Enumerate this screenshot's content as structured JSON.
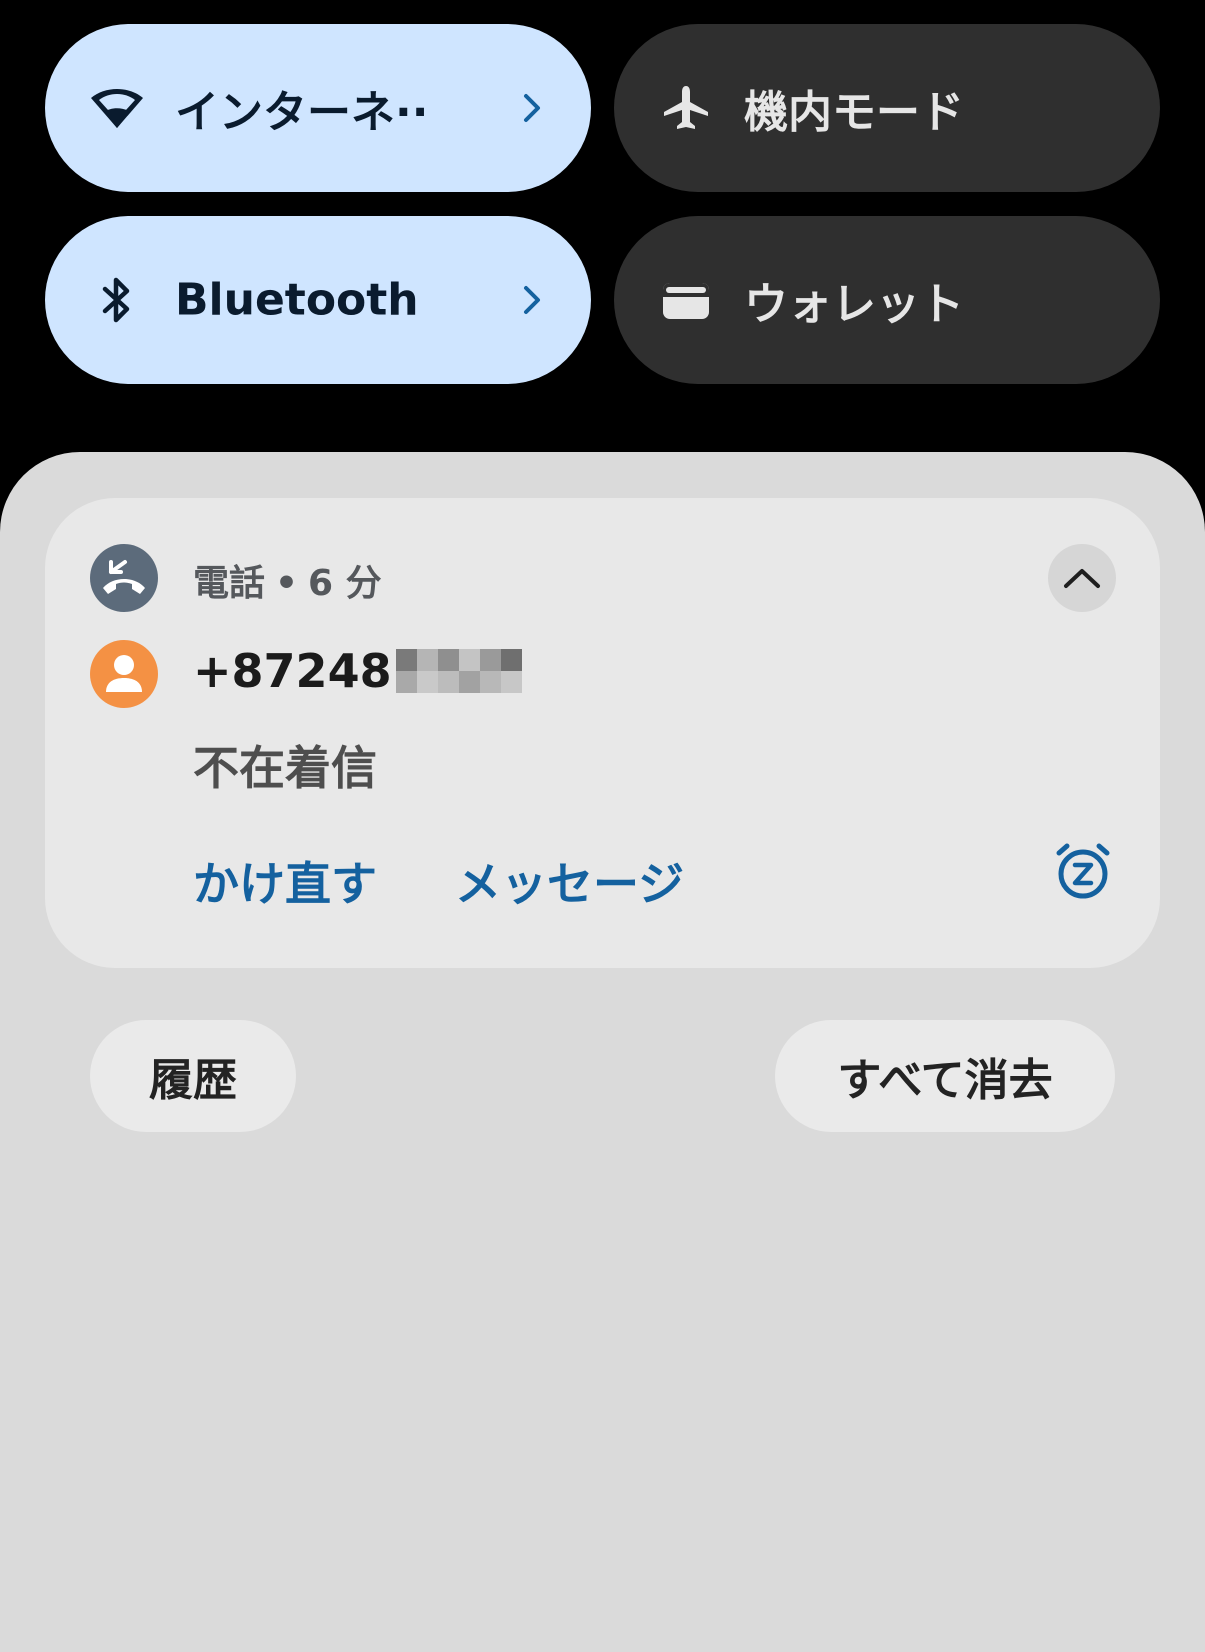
{
  "quick_settings": {
    "tiles": [
      {
        "label": "インターネ··",
        "icon": "wifi-icon",
        "state": "on",
        "chevron": true
      },
      {
        "label": "機内モード",
        "icon": "airplane-icon",
        "state": "off",
        "chevron": false
      },
      {
        "label": "Bluetooth",
        "icon": "bluetooth-icon",
        "state": "on",
        "chevron": true
      },
      {
        "label": "ウォレット",
        "icon": "wallet-icon",
        "state": "off",
        "chevron": false
      }
    ]
  },
  "notification": {
    "app_name": "電話",
    "separator": "•",
    "time": "6 分",
    "caller_number_visible": "+87248",
    "message": "不在着信",
    "actions": {
      "call_back": "かけ直す",
      "message": "メッセージ"
    }
  },
  "footer": {
    "history_button": "履歴",
    "clear_all_button": "すべて消去"
  },
  "colors": {
    "tile_on_bg": "#cfe5ff",
    "tile_off_bg": "#2f2f2f",
    "shade_bg": "#dadada",
    "card_bg": "#e8e8e8",
    "action_text": "#14619f",
    "avatar_bg": "#f49144",
    "app_icon_bg": "#5c6b7b"
  }
}
